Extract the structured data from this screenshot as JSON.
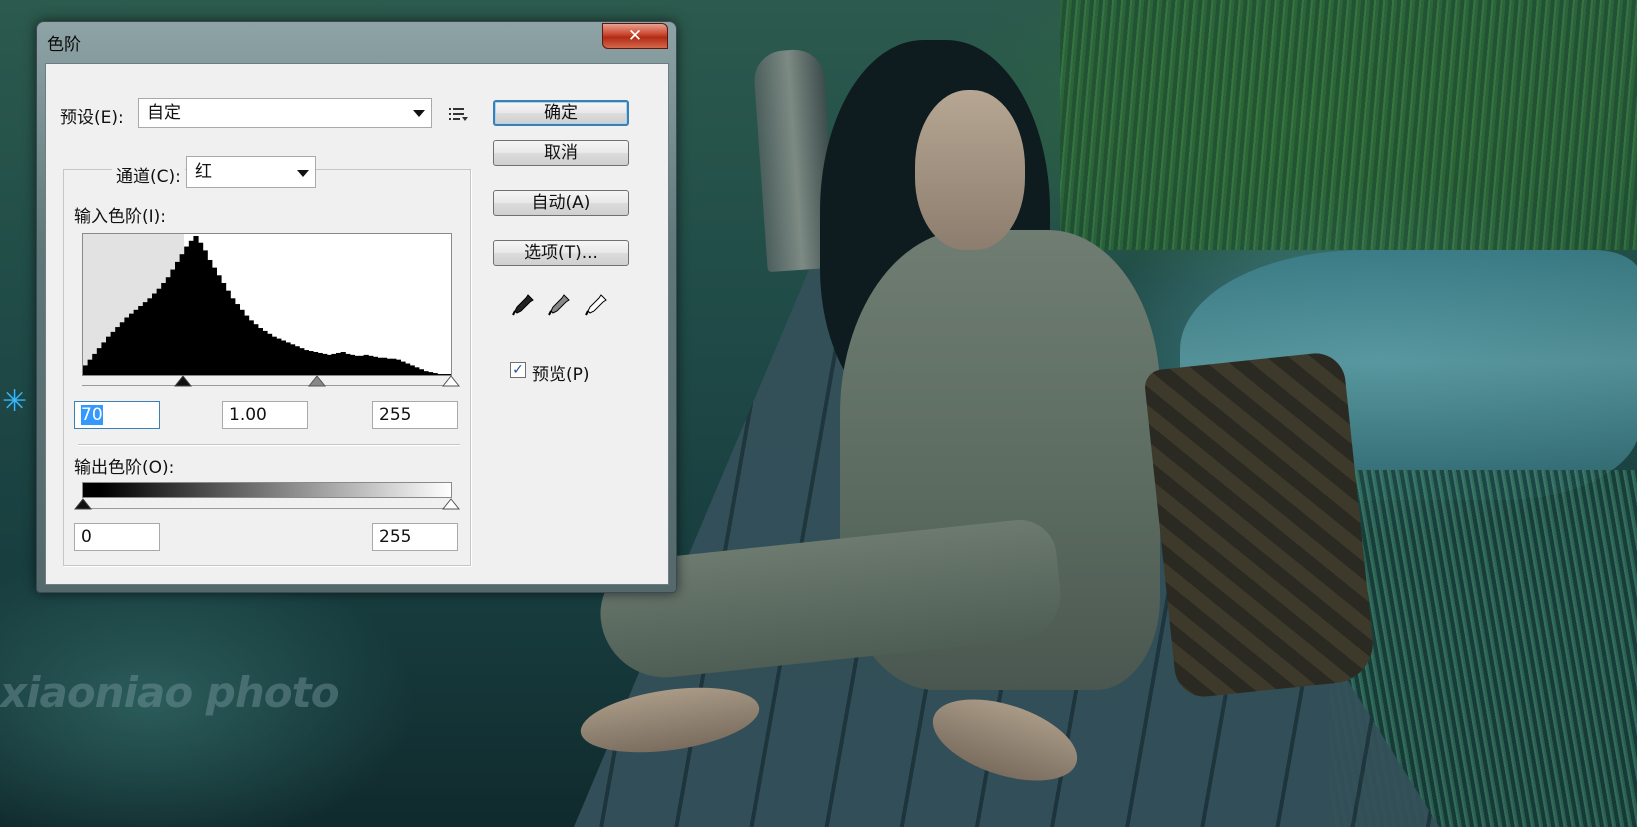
{
  "dialog": {
    "title": "色阶",
    "close_glyph": "✕",
    "preset_label": "预设(E):",
    "preset_value": "自定",
    "channel_label": "通道(C):",
    "channel_value": "红",
    "input_levels_label": "输入色阶(I):",
    "input_black": "70",
    "input_gamma": "1.00",
    "input_white": "255",
    "output_levels_label": "输出色阶(O):",
    "output_black": "0",
    "output_white": "255",
    "buttons": {
      "ok": "确定",
      "cancel": "取消",
      "auto": "自动(A)",
      "options": "选项(T)..."
    },
    "preview_label": "预览(P)",
    "preview_checked": true,
    "icons": [
      "preset-menu-icon",
      "black-eyedropper-icon",
      "gray-eyedropper-icon",
      "white-eyedropper-icon"
    ]
  },
  "histogram": {
    "bins": [
      10,
      16,
      22,
      28,
      34,
      40,
      45,
      50,
      55,
      60,
      64,
      68,
      72,
      76,
      80,
      85,
      90,
      96,
      102,
      110,
      118,
      126,
      134,
      140,
      145,
      138,
      130,
      120,
      112,
      104,
      96,
      88,
      80,
      74,
      68,
      62,
      57,
      53,
      49,
      46,
      43,
      40,
      38,
      36,
      34,
      32,
      30,
      28,
      26,
      25,
      24,
      23,
      22,
      21,
      22,
      23,
      24,
      22,
      21,
      20,
      20,
      21,
      20,
      19,
      18,
      18,
      17,
      17,
      16,
      14,
      12,
      10,
      8,
      6,
      4,
      3,
      2,
      1,
      1,
      1
    ],
    "input_black_level": 70,
    "input_gamma_level": 1.0,
    "input_white_level": 255
  },
  "background": {
    "watermark": "xiaoniao photo"
  }
}
